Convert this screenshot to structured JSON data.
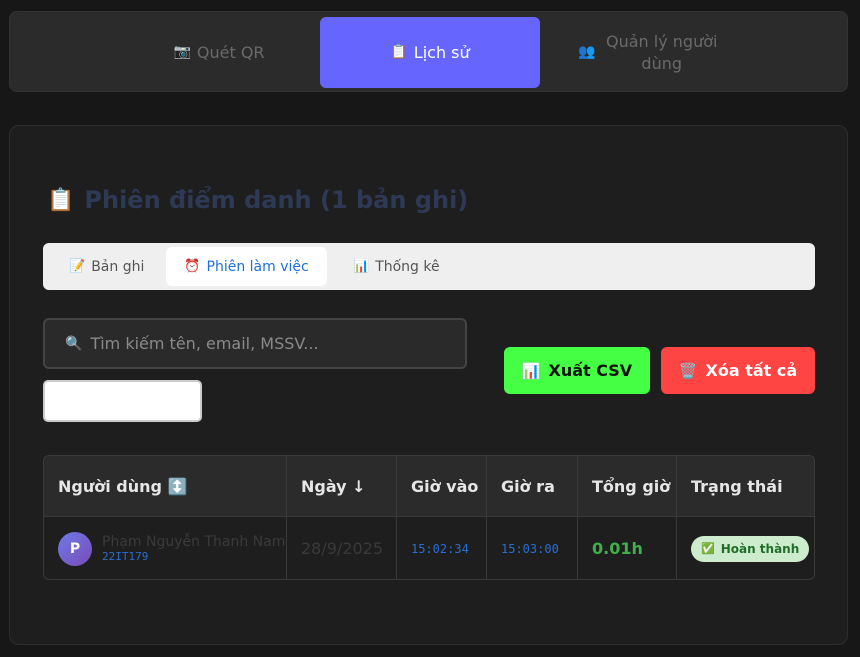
{
  "nav": {
    "tabs": [
      {
        "icon": "📷",
        "label": "Quét QR"
      },
      {
        "icon": "📋",
        "label": "Lịch sử"
      },
      {
        "icon": "👥",
        "label": "Quản lý người dùng"
      }
    ]
  },
  "main": {
    "title_icon": "📋",
    "title": "Phiên điểm danh (1 bản ghi)",
    "subtabs": [
      {
        "icon": "📝",
        "label": "Bản ghi"
      },
      {
        "icon": "⏰",
        "label": "Phiên làm việc"
      },
      {
        "icon": "📊",
        "label": "Thống kê"
      }
    ],
    "search": {
      "icon": "🔍",
      "placeholder": "Tìm kiếm tên, email, MSSV..."
    },
    "buttons": {
      "export": {
        "icon": "📊",
        "label": "Xuất CSV"
      },
      "clear": {
        "icon": "🗑️",
        "label": "Xóa tất cả"
      }
    },
    "table": {
      "headers": [
        "Người dùng ↕️",
        "Ngày ↓",
        "Giờ vào",
        "Giờ ra",
        "Tổng giờ",
        "Trạng thái"
      ],
      "rows": [
        {
          "avatar": "P",
          "name": "Phạm Nguyễn Thanh Nam",
          "student_id": "22IT179",
          "date": "28/9/2025",
          "time_in": "15:02:34",
          "time_out": "15:03:00",
          "total": "0.01h",
          "status_icon": "✅",
          "status": "Hoàn thành"
        }
      ]
    }
  }
}
